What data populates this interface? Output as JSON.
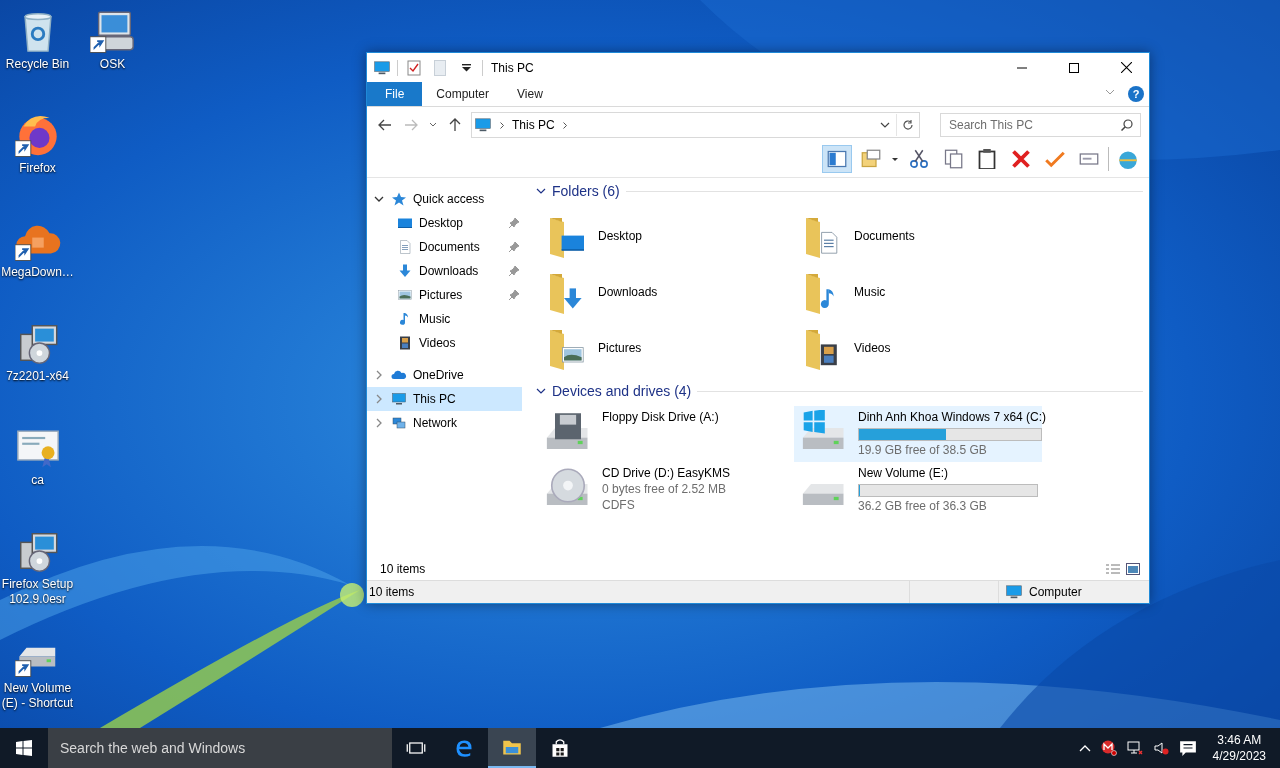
{
  "desktop_icons": [
    {
      "label": "Recycle Bin",
      "kind": "recycle",
      "shortcut": false
    },
    {
      "label": "Firefox",
      "kind": "firefox",
      "shortcut": true
    },
    {
      "label": "MegaDown…",
      "kind": "cloud",
      "shortcut": true
    },
    {
      "label": "7z2201-x64",
      "kind": "installer",
      "shortcut": false
    },
    {
      "label": "ca",
      "kind": "certificate",
      "shortcut": false
    },
    {
      "label": "Firefox Setup 102.9.0esr",
      "kind": "installer",
      "shortcut": false
    },
    {
      "label": "New Volume (E) - Shortcut",
      "kind": "drive",
      "shortcut": true
    },
    {
      "label": "OSK",
      "kind": "keyboard",
      "shortcut": true
    }
  ],
  "window": {
    "title": "This PC",
    "ribbon_tabs": [
      {
        "label": "File",
        "kind": "file",
        "selected": false
      },
      {
        "label": "Computer",
        "kind": "tab",
        "selected": false
      },
      {
        "label": "View",
        "kind": "tab",
        "selected": false
      }
    ],
    "help": "?",
    "address": {
      "crumbs": [
        "This PC"
      ]
    },
    "search": {
      "placeholder": "Search This PC"
    },
    "nav": [
      {
        "label": "Quick access",
        "kind": "star",
        "expanded": true,
        "selected": false,
        "children": [
          {
            "label": "Desktop",
            "kind": "desktop",
            "pinned": true,
            "selected": false
          },
          {
            "label": "Documents",
            "kind": "documents",
            "pinned": true,
            "selected": false
          },
          {
            "label": "Downloads",
            "kind": "downloads",
            "pinned": true,
            "selected": false
          },
          {
            "label": "Pictures",
            "kind": "pictures",
            "pinned": true,
            "selected": false
          },
          {
            "label": "Music",
            "kind": "music",
            "pinned": false,
            "selected": false
          },
          {
            "label": "Videos",
            "kind": "videos",
            "pinned": false,
            "selected": false
          }
        ]
      },
      {
        "label": "OneDrive",
        "kind": "cloud",
        "expanded": false,
        "selected": false
      },
      {
        "label": "This PC",
        "kind": "pc",
        "expanded": false,
        "selected": true
      },
      {
        "label": "Network",
        "kind": "network",
        "expanded": false,
        "selected": false
      }
    ],
    "folders": {
      "title": "Folders (6)",
      "expanded": true,
      "items": [
        {
          "label": "Desktop",
          "kind": "desktop"
        },
        {
          "label": "Documents",
          "kind": "documents"
        },
        {
          "label": "Downloads",
          "kind": "downloads"
        },
        {
          "label": "Music",
          "kind": "music"
        },
        {
          "label": "Pictures",
          "kind": "pictures"
        },
        {
          "label": "Videos",
          "kind": "videos"
        }
      ]
    },
    "drives": {
      "title": "Devices and drives (4)",
      "expanded": true,
      "items": [
        {
          "name": "Floppy Disk Drive (A:)",
          "kind": "floppy",
          "selected": false
        },
        {
          "name": "Dinh Anh Khoa Windows 7 x64 (C:)",
          "kind": "windows",
          "selected": true,
          "level": 0.48,
          "details": [
            "19.9 GB free of 38.5 GB"
          ]
        },
        {
          "name": "CD Drive (D:) EasyKMS",
          "kind": "cd",
          "selected": false,
          "details": [
            "0 bytes free of 2.52 MB",
            "CDFS"
          ]
        },
        {
          "name": "New Volume (E:)",
          "kind": "disk",
          "selected": false,
          "level": 0.003,
          "details": [
            "36.2 GB free of 36.3 GB"
          ]
        }
      ]
    },
    "item_count": "10 items",
    "status_bar": {
      "count": "10 items",
      "location": "Computer"
    }
  },
  "taskbar": {
    "search_placeholder": "Search the web and Windows",
    "apps": [
      {
        "kind": "taskview",
        "selected": false
      },
      {
        "kind": "edge",
        "selected": false
      },
      {
        "kind": "explorer",
        "selected": true
      },
      {
        "kind": "store",
        "selected": false
      }
    ],
    "time": "3:46 AM",
    "date": "4/29/2023"
  }
}
